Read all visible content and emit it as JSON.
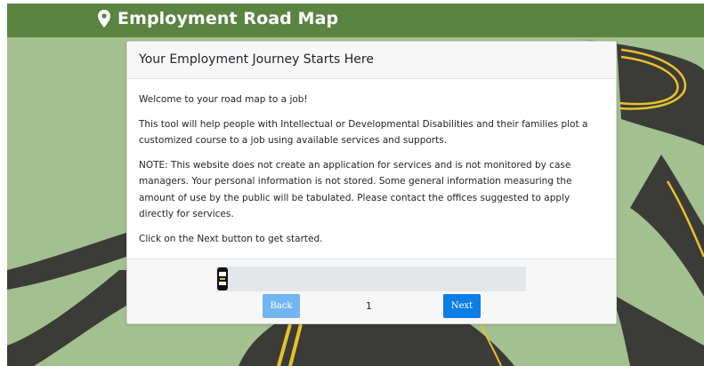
{
  "header": {
    "title": "Employment Road Map",
    "icon": "map-pin-icon",
    "background": "#5b8443"
  },
  "card": {
    "title": "Your Employment Journey Starts Here",
    "paragraphs": [
      "Welcome to your road map to a job!",
      "This tool will help people with Intellectual or Developmental Disabilities and their families plot a customized course to a job using available services and supports.",
      "NOTE: This website does not create an application for services and is not monitored by case managers. Your personal information is not stored. Some general information measuring the amount of use by the public will be tabulated. Please contact the offices suggested to apply directly for services.",
      "Click on the Next button to get started."
    ]
  },
  "footer": {
    "progress_icon": "car-icon",
    "back_label": "Back",
    "page_number": "1",
    "next_label": "Next"
  },
  "colors": {
    "grass": "#a3c090",
    "road": "#3b3b38",
    "road_line": "#e9c12b",
    "primary_button": "#0d7de8",
    "disabled_button": "#73b5f0"
  }
}
